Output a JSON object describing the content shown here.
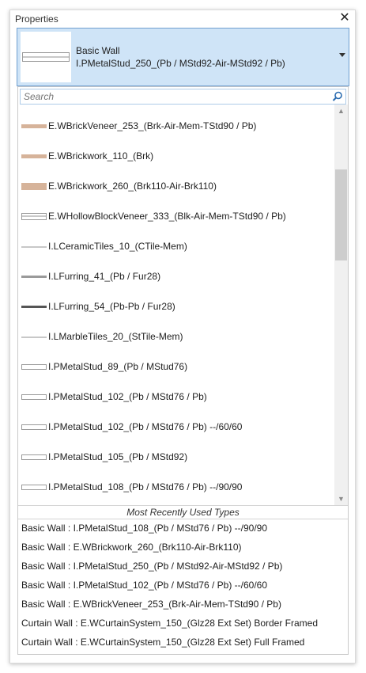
{
  "panel": {
    "title": "Properties",
    "close_glyph": "✕"
  },
  "selector": {
    "family": "Basic Wall",
    "type_name": "I.PMetalStud_250_(Pb / MStd92-Air-MStd92 / Pb)",
    "highlight_color": "#cfe4f7",
    "border_color": "#6f9fd0"
  },
  "search": {
    "placeholder": "Search",
    "icon": "search-icon"
  },
  "type_list": [
    {
      "label": "E.WBrickVeneer_253_(Brk-Air-Mem-TStd90 / Pb)",
      "swatch": "brick-thin"
    },
    {
      "label": "E.WBrickwork_110_(Brk)",
      "swatch": "brick-thin"
    },
    {
      "label": "E.WBrickwork_260_(Brk110-Air-Brk110)",
      "swatch": "brick-thick"
    },
    {
      "label": "E.WHollowBlockVeneer_333_(Blk-Air-Mem-TStd90 / Pb)",
      "swatch": "hollow"
    },
    {
      "label": "I.LCeramicTiles_10_(CTile-Mem)",
      "swatch": "line-light"
    },
    {
      "label": "I.LFurring_41_(Pb / Fur28)",
      "swatch": "line-mid"
    },
    {
      "label": "I.LFurring_54_(Pb-Pb / Fur28)",
      "swatch": "line-dark"
    },
    {
      "label": "I.LMarbleTiles_20_(StTile-Mem)",
      "swatch": "line-light"
    },
    {
      "label": "I.PMetalStud_89_(Pb / MStud76)",
      "swatch": "double"
    },
    {
      "label": "I.PMetalStud_102_(Pb / MStd76 / Pb)",
      "swatch": "double"
    },
    {
      "label": "I.PMetalStud_102_(Pb / MStd76 / Pb) --/60/60",
      "swatch": "double"
    },
    {
      "label": "I.PMetalStud_105_(Pb / MStd92)",
      "swatch": "double"
    },
    {
      "label": "I.PMetalStud_108_(Pb / MStd76 / Pb) --/90/90",
      "swatch": "double"
    }
  ],
  "swatch_colors": {
    "brick": "#d6b39a",
    "line_light": "#c8c8c8",
    "line_mid": "#9a9a9a",
    "line_dark": "#555555"
  },
  "mru": {
    "header": "Most Recently Used Types",
    "items": [
      "Basic Wall : I.PMetalStud_108_(Pb / MStd76 / Pb) --/90/90",
      "Basic Wall : E.WBrickwork_260_(Brk110-Air-Brk110)",
      "Basic Wall : I.PMetalStud_250_(Pb / MStd92-Air-MStd92 / Pb)",
      "Basic Wall : I.PMetalStud_102_(Pb / MStd76 / Pb) --/60/60",
      "Basic Wall : E.WBrickVeneer_253_(Brk-Air-Mem-TStd90 / Pb)",
      "Curtain Wall : E.WCurtainSystem_150_(Glz28 Ext Set)  Border Framed",
      "Curtain Wall : E.WCurtainSystem_150_(Glz28 Ext Set) Full Framed"
    ]
  }
}
